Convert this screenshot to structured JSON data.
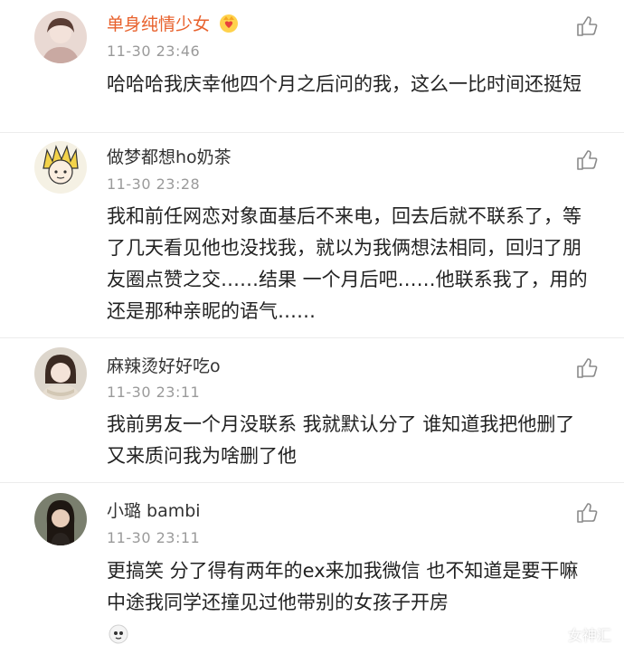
{
  "comments": [
    {
      "name": "单身纯情少女",
      "time": "11-30 23:46",
      "text": "哈哈哈我庆幸他四个月之后问的我，这么一比时间还挺短",
      "vip_icon": "crown-heart-icon",
      "avatar": "photo-avatar-girl"
    },
    {
      "name": "做梦都想ho奶茶",
      "time": "11-30 23:28",
      "text": "我和前任网恋对象面基后不来电，回去后就不联系了，等了几天看见他也没找我，就以为我俩想法相同，回归了朋友圈点赞之交……结果 一个月后吧……他联系我了，用的还是那种亲昵的语气……",
      "avatar": "anime-avatar"
    },
    {
      "name": "麻辣烫好好吃o",
      "time": "11-30 23:11",
      "text": "我前男友一个月没联系 我就默认分了  谁知道我把他删了又来质问我为啥删了他",
      "avatar": "photo-avatar-girl-scarf"
    },
    {
      "name": "小璐 bambi",
      "time": "11-30 23:11",
      "text": "更搞笑 分了得有两年的ex来加我微信 也不知道是要干嘛 中途我同学还撞见过他带别的女孩子开房",
      "avatar": "photo-avatar-girl-dark"
    }
  ],
  "watermark": {
    "text": "女神汇",
    "icon": "wechat-channel-icon"
  },
  "colors": {
    "vip_name": "#e8612c",
    "name": "#333333",
    "time": "#9a9a9a",
    "text": "#222222"
  }
}
